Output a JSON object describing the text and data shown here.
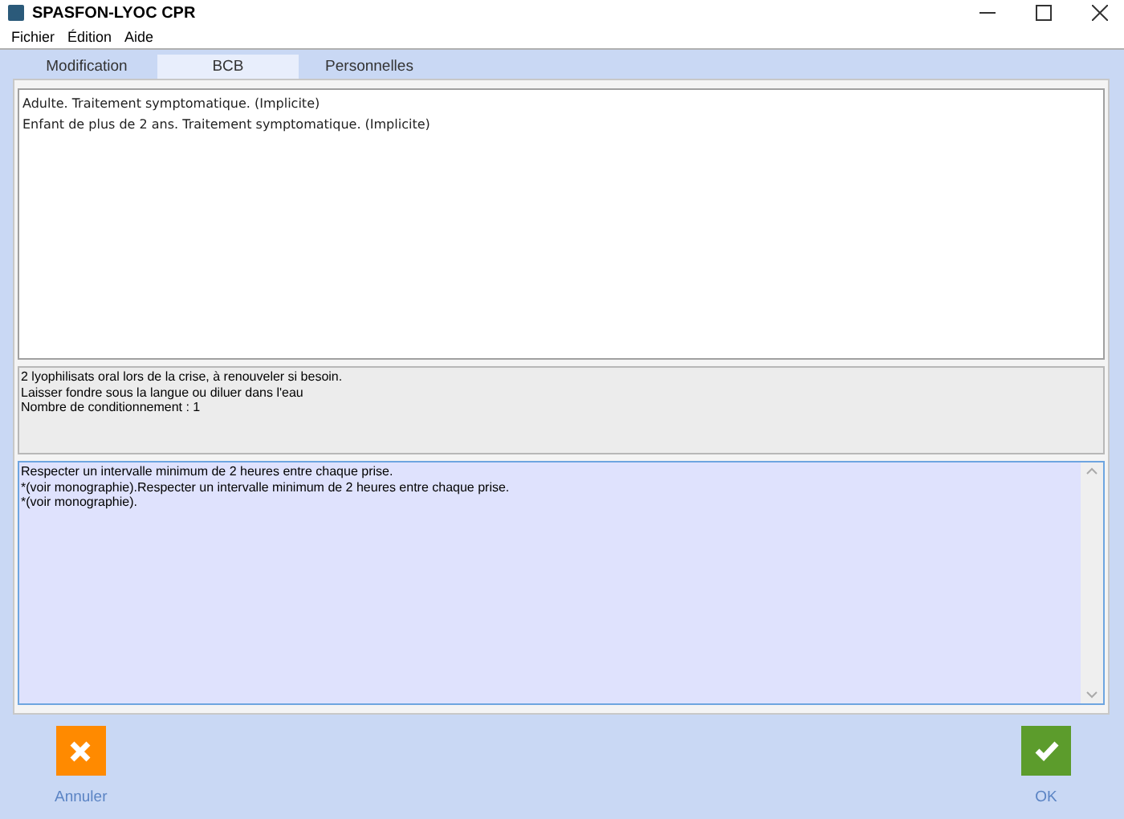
{
  "window": {
    "title": "SPASFON-LYOC CPR"
  },
  "menu": [
    "Fichier",
    "Édition",
    "Aide"
  ],
  "tabs": [
    {
      "label": "Modification",
      "selected": false
    },
    {
      "label": "BCB",
      "selected": true
    },
    {
      "label": "Personnelles",
      "selected": false
    }
  ],
  "indications": [
    "Adulte. Traitement symptomatique. (Implicite)",
    "Enfant de plus de 2 ans. Traitement symptomatique. (Implicite)"
  ],
  "posology": [
    "2 lyophilisats oral lors de la crise, à renouveler si besoin.",
    "Laisser fondre sous la langue ou diluer dans l'eau",
    "Nombre de conditionnement : 1"
  ],
  "notes": [
    "Respecter un intervalle minimum de 2 heures entre chaque prise.",
    "*(voir monographie).Respecter un intervalle minimum de 2 heures entre chaque prise.",
    "*(voir monographie)."
  ],
  "buttons": [
    {
      "kind": "cancel",
      "label": "Annuler"
    },
    {
      "kind": "ok",
      "label": "OK"
    }
  ]
}
